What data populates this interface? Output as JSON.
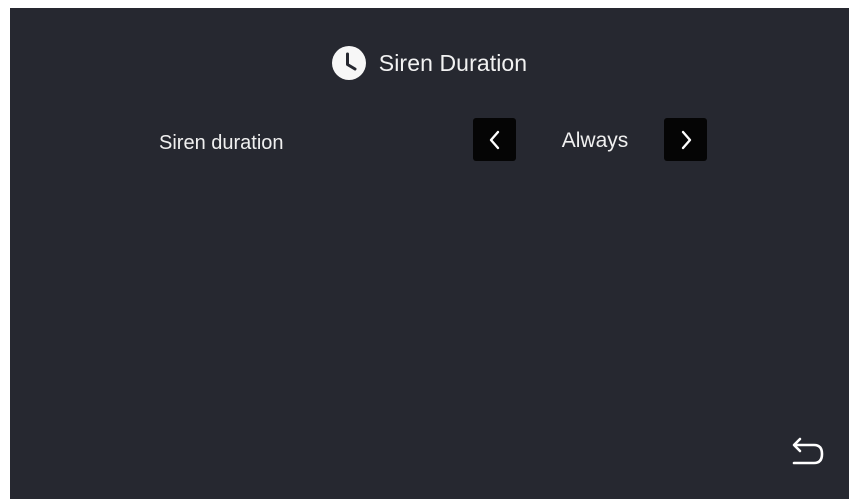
{
  "header": {
    "icon": "clock-icon",
    "title": "Siren Duration"
  },
  "setting": {
    "label": "Siren duration",
    "value": "Always",
    "prev_icon": "chevron-left-icon",
    "next_icon": "chevron-right-icon"
  },
  "footer": {
    "back_icon": "back-arrow-icon"
  },
  "colors": {
    "background": "#262830",
    "text": "#f2f2f2",
    "arrow_button": "#050505"
  }
}
